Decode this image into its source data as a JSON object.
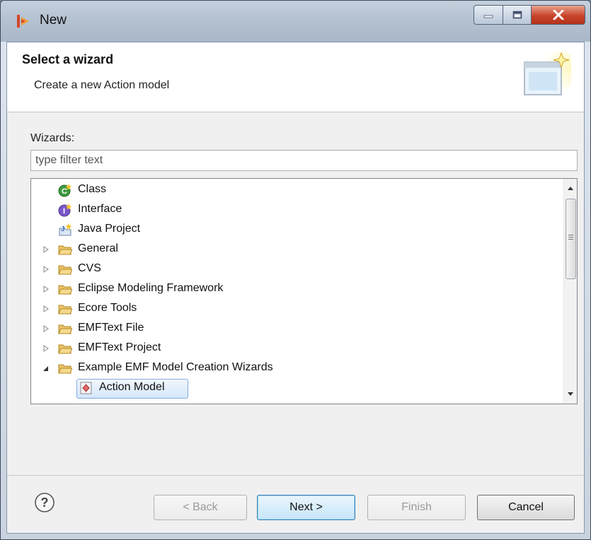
{
  "window": {
    "title": "New",
    "controls": {
      "minimize": "minimize-icon",
      "maximize": "maximize-icon",
      "close": "close-icon"
    }
  },
  "header": {
    "title": "Select a wizard",
    "description": "Create a new Action model"
  },
  "wizards": {
    "label": "Wizards:",
    "filter_placeholder": "type filter text",
    "items": [
      {
        "label": "Class",
        "icon": "java-class-icon",
        "expander": "none"
      },
      {
        "label": "Interface",
        "icon": "java-interface-icon",
        "expander": "none"
      },
      {
        "label": "Java Project",
        "icon": "java-project-icon",
        "expander": "none"
      },
      {
        "label": "General",
        "icon": "folder-icon",
        "expander": "collapsed"
      },
      {
        "label": "CVS",
        "icon": "folder-icon",
        "expander": "collapsed"
      },
      {
        "label": "Eclipse Modeling Framework",
        "icon": "folder-icon",
        "expander": "collapsed"
      },
      {
        "label": "Ecore Tools",
        "icon": "folder-icon",
        "expander": "collapsed"
      },
      {
        "label": "EMFText File",
        "icon": "folder-icon",
        "expander": "collapsed"
      },
      {
        "label": "EMFText Project",
        "icon": "folder-icon",
        "expander": "collapsed"
      },
      {
        "label": "Example EMF Model Creation Wizards",
        "icon": "folder-icon",
        "expander": "expanded"
      },
      {
        "label": "Action Model",
        "icon": "action-model-icon",
        "expander": "none",
        "selected": true
      }
    ]
  },
  "buttons": {
    "back": "< Back",
    "next": "Next >",
    "finish": "Finish",
    "cancel": "Cancel"
  },
  "colors": {
    "selection_border": "#84acdd",
    "folder": "#e9c46a",
    "default_button_border": "#3c7fb1"
  }
}
